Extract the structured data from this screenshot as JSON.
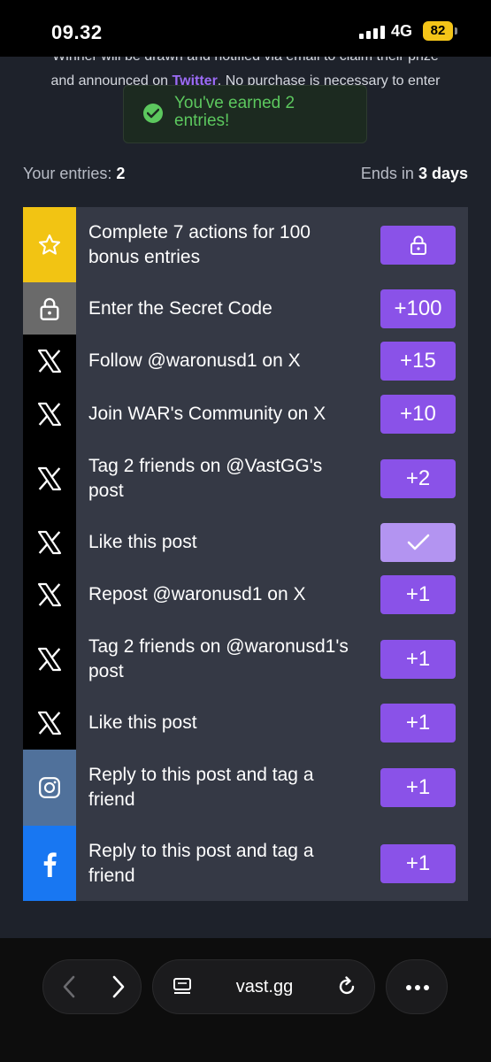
{
  "status": {
    "time": "09.32",
    "network": "4G",
    "battery": "82"
  },
  "intro": {
    "line1": "Winner will be drawn and notified via email to claim their prize",
    "line2_prefix": "and announced on",
    "twitter_link": "Twitter",
    "line2_suffix": ". No purchase is necessary to enter"
  },
  "toast": {
    "message": "You've earned 2 entries!"
  },
  "summary": {
    "entries_label": "Your entries: ",
    "entries_value": "2",
    "ends_label": "Ends in ",
    "ends_value": "3 days"
  },
  "actions": [
    {
      "icon": "star-icon",
      "label": "Complete 7 actions for 100 bonus entries",
      "button": "",
      "button_icon": "lock-icon"
    },
    {
      "icon": "lock-icon",
      "label": "Enter the Secret Code",
      "button": "+100"
    },
    {
      "icon": "x-logo-icon",
      "label": "Follow @waronusd1 on X",
      "button": "+15"
    },
    {
      "icon": "x-logo-icon",
      "label": "Join WAR's Community on X",
      "button": "+10"
    },
    {
      "icon": "x-logo-icon",
      "label": "Tag 2 friends on @VastGG's post",
      "button": "+2"
    },
    {
      "icon": "x-logo-icon",
      "label": "Like this post",
      "button": "",
      "button_icon": "checkmark-icon",
      "completed": true
    },
    {
      "icon": "x-logo-icon",
      "label": "Repost @waronusd1 on X",
      "button": "+1"
    },
    {
      "icon": "x-logo-icon",
      "label": "Tag 2 friends on @waronusd1's post",
      "button": "+1"
    },
    {
      "icon": "x-logo-icon",
      "label": "Like this post",
      "button": "+1"
    },
    {
      "icon": "instagram-icon",
      "label": "Reply to this post and tag a friend",
      "button": "+1"
    },
    {
      "icon": "facebook-icon",
      "label": "Reply to this post and tag a friend",
      "button": "+1"
    }
  ],
  "browser": {
    "url": "vast.gg"
  },
  "colors": {
    "accent": "#8a52e8",
    "toast_green": "#5cc85e",
    "star_yellow": "#f2c413",
    "facebook_blue": "#1877f2"
  }
}
